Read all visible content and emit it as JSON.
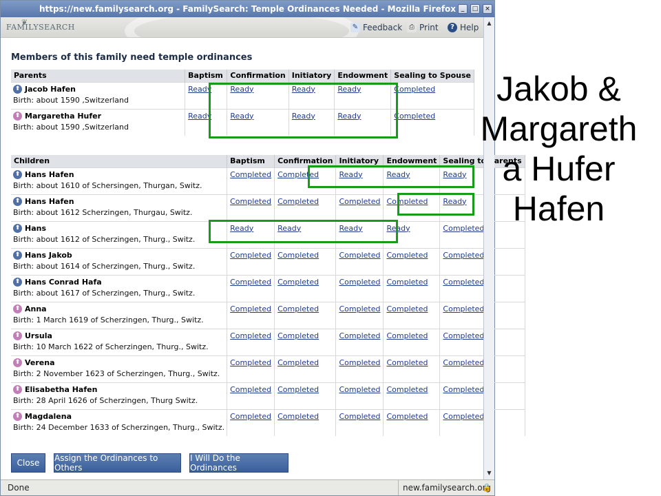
{
  "window": {
    "title": "https://new.familysearch.org - FamilySearch: Temple Ordinances Needed - Mozilla Firefox",
    "controls": [
      "_",
      "□",
      "×"
    ]
  },
  "header": {
    "logo": "FAMILYSEARCH",
    "feedback": "Feedback",
    "print": "Print",
    "help": "Help"
  },
  "heading": "Members of this family need temple ordinances",
  "parents_table": {
    "columns": [
      "Parents",
      "Baptism",
      "Confirmation",
      "Initiatory",
      "Endowment",
      "Sealing to Spouse"
    ],
    "rows": [
      {
        "gender": "male",
        "name": "Jacob Hafen",
        "birth": "Birth: about 1590 ,Switzerland",
        "statuses": [
          "Ready",
          "Ready",
          "Ready",
          "Ready",
          "Completed"
        ]
      },
      {
        "gender": "female",
        "name": "Margaretha Hufer",
        "birth": "Birth: about 1590 ,Switzerland",
        "statuses": [
          "Ready",
          "Ready",
          "Ready",
          "Ready",
          "Completed"
        ]
      }
    ]
  },
  "children_table": {
    "columns": [
      "Children",
      "Baptism",
      "Confirmation",
      "Initiatory",
      "Endowment",
      "Sealing to Parents"
    ],
    "rows": [
      {
        "gender": "male",
        "name": "Hans Hafen",
        "birth": "Birth: about 1610 of Schersingen, Thurgan, Switz.",
        "statuses": [
          "Completed",
          "Completed",
          "Ready",
          "Ready",
          "Ready"
        ]
      },
      {
        "gender": "male",
        "name": "Hans Hafen",
        "birth": "Birth: about 1612 Scherzingen, Thurgau, Switz.",
        "statuses": [
          "Completed",
          "Completed",
          "Completed",
          "Completed",
          "Ready"
        ]
      },
      {
        "gender": "male",
        "name": "Hans",
        "birth": "Birth: about 1612 of Scherzingen, Thurg., Switz.",
        "statuses": [
          "Ready",
          "Ready",
          "Ready",
          "Ready",
          "Completed"
        ]
      },
      {
        "gender": "male",
        "name": "Hans Jakob",
        "birth": "Birth: about 1614 of Scherzingen, Thurg., Switz.",
        "statuses": [
          "Completed",
          "Completed",
          "Completed",
          "Completed",
          "Completed"
        ]
      },
      {
        "gender": "male",
        "name": "Hans Conrad Hafa",
        "birth": "Birth: about 1617 of Scherzingen, Thurg., Switz.",
        "statuses": [
          "Completed",
          "Completed",
          "Completed",
          "Completed",
          "Completed"
        ]
      },
      {
        "gender": "female",
        "name": "Anna",
        "birth": "Birth: 1 March 1619 of Scherzingen, Thurg., Switz.",
        "statuses": [
          "Completed",
          "Completed",
          "Completed",
          "Completed",
          "Completed"
        ]
      },
      {
        "gender": "female",
        "name": "Ursula",
        "birth": "Birth: 10 March 1622 of Scherzingen, Thurg., Switz.",
        "statuses": [
          "Completed",
          "Completed",
          "Completed",
          "Completed",
          "Completed"
        ]
      },
      {
        "gender": "female",
        "name": "Verena",
        "birth": "Birth: 2 November 1623 of Scherzingen, Thurg., Switz.",
        "statuses": [
          "Completed",
          "Completed",
          "Completed",
          "Completed",
          "Completed"
        ]
      },
      {
        "gender": "female",
        "name": "Elisabetha Hafen",
        "birth": "Birth: 28 April 1626 of Scherzingen, Thurg Switz.",
        "statuses": [
          "Completed",
          "Completed",
          "Completed",
          "Completed",
          "Completed"
        ]
      },
      {
        "gender": "female",
        "name": "Magdalena",
        "birth": "Birth: 24 December 1633 of Scherzingen, Thurg., Switz.",
        "statuses": [
          "Completed",
          "Completed",
          "Completed",
          "Completed",
          "Completed"
        ]
      }
    ]
  },
  "buttons": {
    "close": "Close",
    "assign": "Assign the Ordinances to Others",
    "will_do": "I Will Do the Ordinances"
  },
  "statusbar": {
    "left": "Done",
    "right": "new.familysearch.org"
  },
  "caption": {
    "lines": [
      "Jakob &",
      "Margareth",
      "a Hufer",
      "Hafen"
    ]
  },
  "colors": {
    "highlight": "#1a9a1a",
    "male_icon": "#4f6fa5",
    "female_icon": "#c27fb7",
    "link": "#1f3a8f"
  }
}
